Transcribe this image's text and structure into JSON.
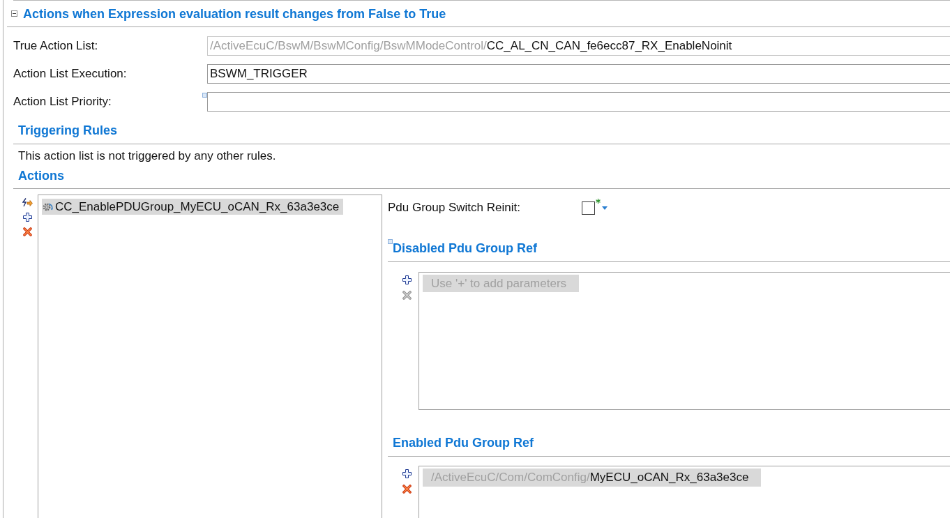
{
  "section": {
    "title": "Actions when Expression evaluation result changes from False to True",
    "expanded": true
  },
  "fields": [
    {
      "label": "True Action List:",
      "kind": "reference",
      "path": "/ActiveEcuC/BswM/BswMConfig/BswMModeControl/",
      "value": "CC_AL_CN_CAN_fe6ecc87_RX_EnableNoinit",
      "has_marker": false
    },
    {
      "label": "Action List Execution:",
      "kind": "text",
      "value": "BSWM_TRIGGER",
      "has_marker": false
    },
    {
      "label": "Action List Priority:",
      "kind": "text",
      "has_marker": true
    }
  ],
  "triggering_rules": {
    "title": "Triggering Rules",
    "message": "This action list is not triggered by any other rules."
  },
  "actions": {
    "title": "Actions",
    "remove_disabled": false,
    "items": [
      {
        "label": "CC_EnablePDUGroup_MyECU_oCAN_Rx_63a3e3ce",
        "selected": true
      }
    ],
    "pdu_group_switch_reinit": {
      "label": "Pdu Group Switch Reinit:",
      "checked": false
    },
    "ref_lists": [
      {
        "title": "Disabled Pdu Group Ref",
        "has_marker": true,
        "placeholder": "Use '+' to add parameters",
        "remove_disabled": true
      },
      {
        "title": "Enabled Pdu Group Ref",
        "has_marker": false,
        "items": [
          {
            "path": "/ActiveEcuC/Com/ComConfig/",
            "name": "MyECU_oCAN_Rx_63a3e3ce"
          }
        ],
        "remove_disabled": false
      }
    ]
  }
}
